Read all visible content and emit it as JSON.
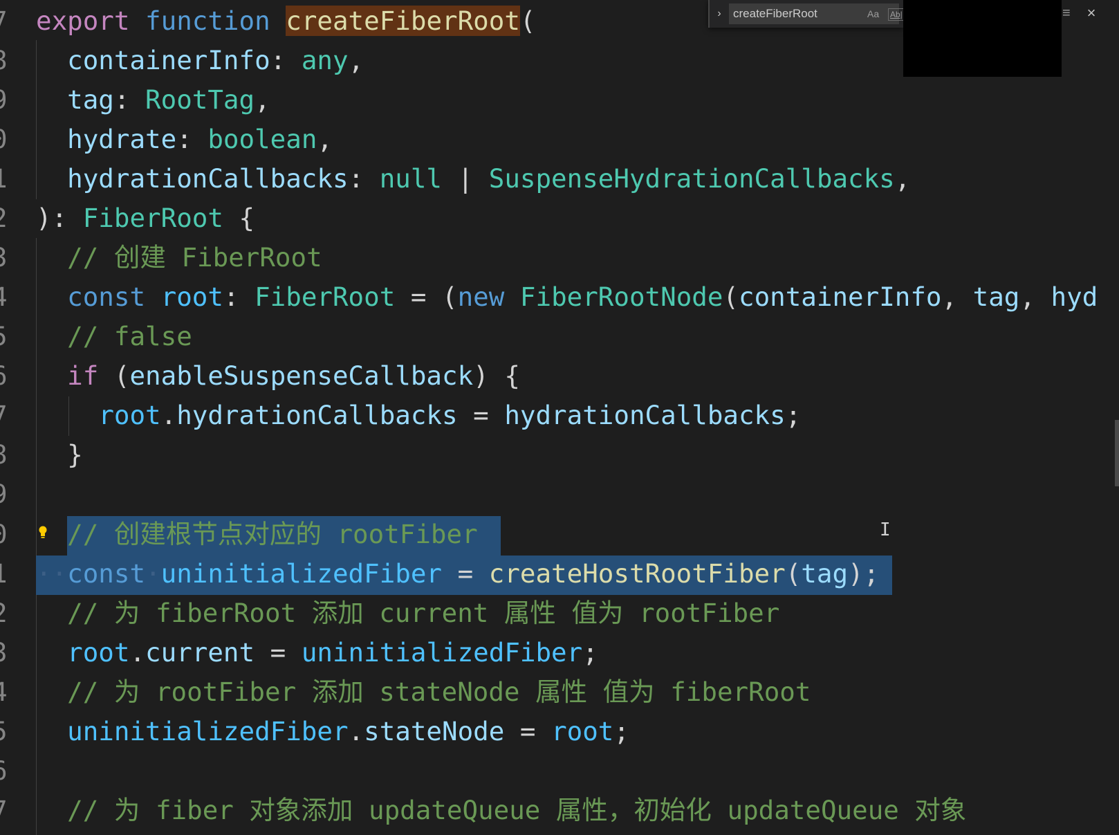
{
  "find_widget": {
    "query": "createFiberRoot",
    "match_case_label": "Aa",
    "whole_word_label": "Ab|"
  },
  "gutter": [
    "7",
    "8",
    "9",
    "0",
    "1",
    "2",
    "3",
    "4",
    "5",
    "6",
    "7",
    "8",
    "9",
    "0",
    "1",
    "2",
    "3",
    "4",
    "5",
    "6",
    "7"
  ],
  "code": {
    "l1": {
      "export": "export",
      "function": "function",
      "name": "createFiberRoot",
      "paren": "("
    },
    "l2": {
      "param": "containerInfo",
      "colon": ": ",
      "type": "any",
      "end": ","
    },
    "l3": {
      "param": "tag",
      "colon": ": ",
      "type": "RootTag",
      "end": ","
    },
    "l4": {
      "param": "hydrate",
      "colon": ": ",
      "type": "boolean",
      "end": ","
    },
    "l5": {
      "param": "hydrationCallbacks",
      "colon": ": ",
      "null": "null",
      "pipe": " | ",
      "type": "SuspenseHydrationCallbacks",
      "end": ","
    },
    "l6": {
      "close": "): ",
      "type": "FiberRoot",
      "brace": " {"
    },
    "l7": {
      "comment": "// 创建 FiberRoot"
    },
    "l8": {
      "const": "const",
      "var": "root",
      "colon": ": ",
      "type": "FiberRoot",
      "eq": " = (",
      "new": "new",
      "cls": "FiberRootNode",
      "args_open": "(",
      "a1": "containerInfo",
      "sep1": ", ",
      "a2": "tag",
      "sep2": ", ",
      "a3": "hyd"
    },
    "l9": {
      "comment": "// false"
    },
    "l10": {
      "if": "if",
      "open": " (",
      "cond": "enableSuspenseCallback",
      "close": ") {"
    },
    "l11": {
      "obj": "root",
      "dot": ".",
      "prop": "hydrationCallbacks",
      "eq": " = ",
      "val": "hydrationCallbacks",
      "end": ";"
    },
    "l12": {
      "brace": "}"
    },
    "l14": {
      "comment": "// 创建根节点对应的 rootFiber"
    },
    "l15": {
      "const": "const",
      "var": "uninitializedFiber",
      "eq": " = ",
      "fn": "createHostRootFiber",
      "open": "(",
      "arg": "tag",
      "close": ");"
    },
    "l16": {
      "comment": "// 为 fiberRoot 添加 current 属性 值为 rootFiber"
    },
    "l17": {
      "obj": "root",
      "dot": ".",
      "prop": "current",
      "eq": " = ",
      "val": "uninitializedFiber",
      "end": ";"
    },
    "l18": {
      "comment": "// 为 rootFiber 添加 stateNode 属性 值为 fiberRoot"
    },
    "l19": {
      "obj": "uninitializedFiber",
      "dot": ".",
      "prop": "stateNode",
      "eq": " = ",
      "val": "root",
      "end": ";"
    },
    "l21": {
      "comment": "// 为 fiber 对象添加 updateQueue 属性，初始化 updateQueue 对象"
    }
  },
  "colors": {
    "background": "#1e1e1e",
    "selection": "#264f78",
    "find_highlight": "#613214",
    "comment": "#6a9955",
    "keyword": "#c586c0",
    "storage": "#569cd6",
    "type": "#4ec9b0",
    "parameter": "#9cdcfe",
    "function": "#dcdcaa",
    "constant": "#4fc1ff"
  },
  "icons": {
    "find_toggle": "chevron-right-icon",
    "menu": "menu-lines-icon",
    "close": "close-icon",
    "lightbulb": "lightbulb-icon",
    "text_cursor": "text-cursor-icon"
  }
}
